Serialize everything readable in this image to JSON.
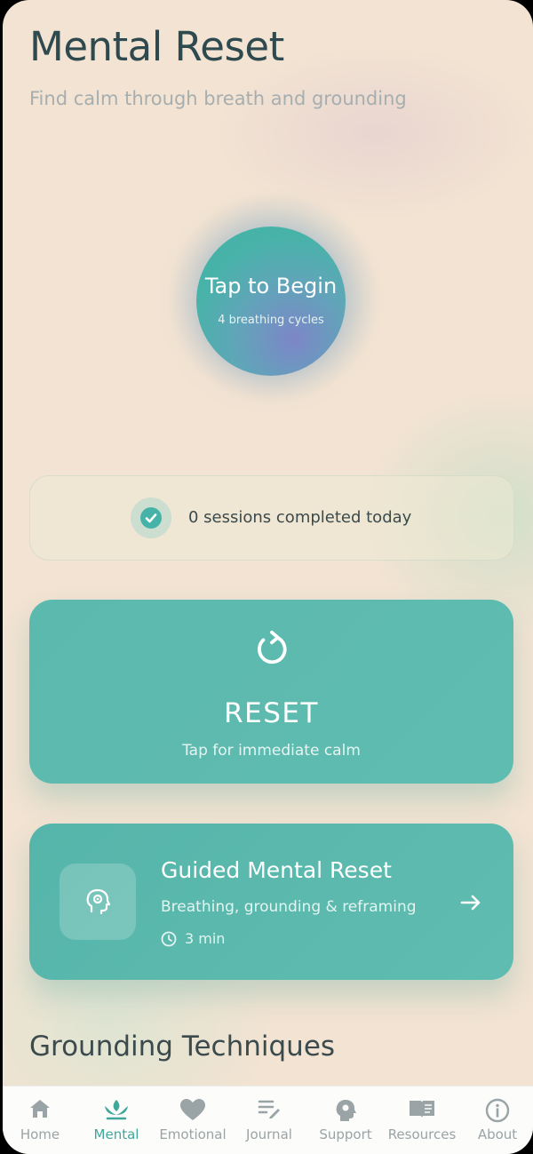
{
  "header": {
    "title": "Mental Reset",
    "subtitle": "Find calm through breath and grounding"
  },
  "breathing": {
    "title": "Tap to Begin",
    "subtitle": "4 breathing cycles"
  },
  "sessions": {
    "text": "0 sessions completed today",
    "icon": "check-circle-icon"
  },
  "reset_card": {
    "icon": "refresh-icon",
    "title": "RESET",
    "subtitle": "Tap for immediate calm"
  },
  "guided_card": {
    "icon": "head-gear-icon",
    "title": "Guided Mental Reset",
    "description": "Breathing, grounding & reframing",
    "duration": "3 min",
    "arrow_icon": "arrow-right-icon"
  },
  "section": {
    "title": "Grounding Techniques"
  },
  "tabbar": {
    "active": "Mental",
    "tabs": [
      {
        "label": "Home",
        "icon": "home-icon"
      },
      {
        "label": "Mental",
        "icon": "lotus-icon"
      },
      {
        "label": "Emotional",
        "icon": "heart-icon"
      },
      {
        "label": "Journal",
        "icon": "journal-pen-icon"
      },
      {
        "label": "Support",
        "icon": "support-icon"
      },
      {
        "label": "Resources",
        "icon": "book-icon"
      },
      {
        "label": "About",
        "icon": "info-icon"
      }
    ]
  },
  "colors": {
    "accent": "#5fbcb0",
    "background": "#f2e3d2",
    "title_text": "#2e4a4f",
    "inactive_tab": "#9aa3a6"
  }
}
